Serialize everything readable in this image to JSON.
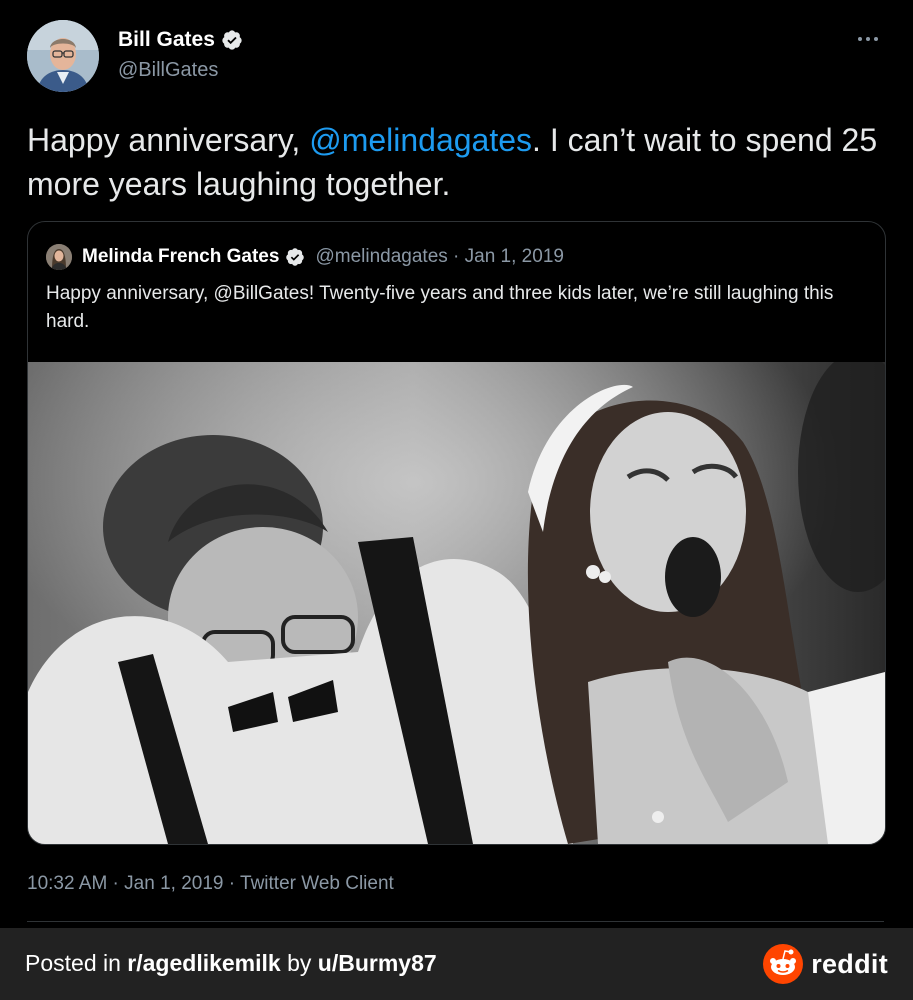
{
  "tweet": {
    "author_name": "Bill Gates",
    "author_handle": "@BillGates",
    "text_before": "Happy anniversary, ",
    "mention": "@melindagates",
    "text_after": ". I can’t wait to spend 25 more years laughing together.",
    "timestamp": "10:32 AM · Jan 1, 2019 · Twitter Web Client",
    "more_icon": "more-horizontal-icon"
  },
  "quote": {
    "author_name": "Melinda French Gates",
    "meta": "@melindagates · Jan 1, 2019",
    "text": "Happy anniversary, @BillGates! Twenty-five years and three kids later, we’re still laughing this hard."
  },
  "footer": {
    "posted_prefix": "Posted in ",
    "subreddit": "r/agedlikemilk",
    "by": " by ",
    "user": "u/Burmy87",
    "brand": "reddit",
    "brand_color": "#ff4500"
  },
  "colors": {
    "link": "#1d9bf0",
    "secondary_text": "#8b98a5",
    "background": "#000000",
    "footer_background": "#222222"
  }
}
